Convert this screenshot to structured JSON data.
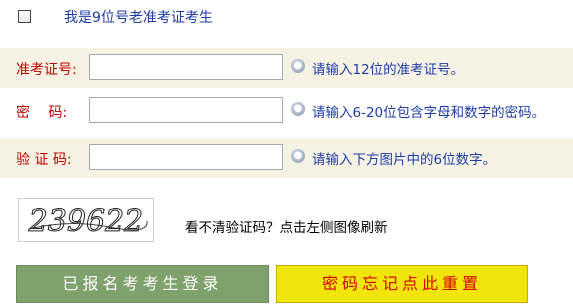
{
  "old_candidate": {
    "label": "我是9位号老准考证考生",
    "checked": false
  },
  "fields": [
    {
      "label": "准考证号:",
      "value": "",
      "hint": "请输入12位的准考证号。"
    },
    {
      "label": "密　  码:",
      "value": "",
      "hint": "请输入6-20位包含字母和数字的密码。"
    },
    {
      "label": "验 证 码:",
      "value": "",
      "hint": "请输入下方图片中的6位数字。"
    }
  ],
  "captcha": {
    "code": "239622",
    "refresh_text": "看不清验证码？点击左侧图像刷新"
  },
  "buttons": {
    "login": "已报名考考生登录",
    "reset": "密码忘记点此重置"
  },
  "colors": {
    "label_red": "#c00000",
    "hint_blue": "#1f3ca6",
    "login_green": "#7fa16b",
    "reset_yellow": "#f2e50b"
  }
}
